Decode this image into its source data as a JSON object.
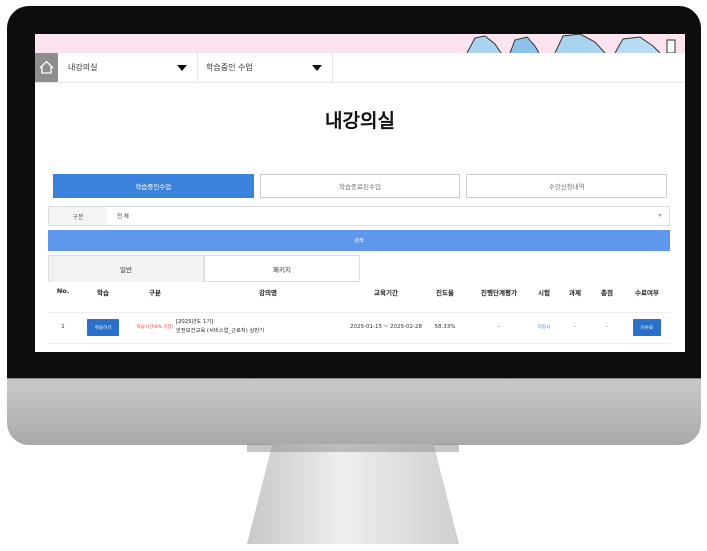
{
  "nav": {
    "menu1": "내강의실",
    "menu2": "학습중인 수업"
  },
  "page_title": "내강의실",
  "tabs": [
    "학습중인수업",
    "학습종료된수업",
    "수강신청내역"
  ],
  "filter": {
    "label": "구분",
    "value": "전 체"
  },
  "search_button": "검색",
  "subtabs": [
    "일반",
    "패키지"
  ],
  "table": {
    "headers": [
      "No.",
      "학습",
      "구분",
      "강의명",
      "교육기간",
      "진도율",
      "진행단계평가",
      "시험",
      "과제",
      "총점",
      "수료여부"
    ],
    "rows": [
      {
        "no": "1",
        "study_button": "학습하기",
        "category": "학습시간(8% 미달)",
        "course_line1": "[2025년도 1기]",
        "course_line2": "안전보건교육 (서비스업_근로자) 상반기",
        "period": "2025-01-15 ~ 2025-02-28",
        "progress": "58.33%",
        "stage_eval": "-",
        "exam": "미응시",
        "assignment": "-",
        "total": "-",
        "completion_button": "미수료"
      }
    ]
  },
  "colors": {
    "accent": "#3a82dc",
    "search": "#5e97ec",
    "button": "#2a6fc8",
    "banner": "#fbe3ef"
  }
}
